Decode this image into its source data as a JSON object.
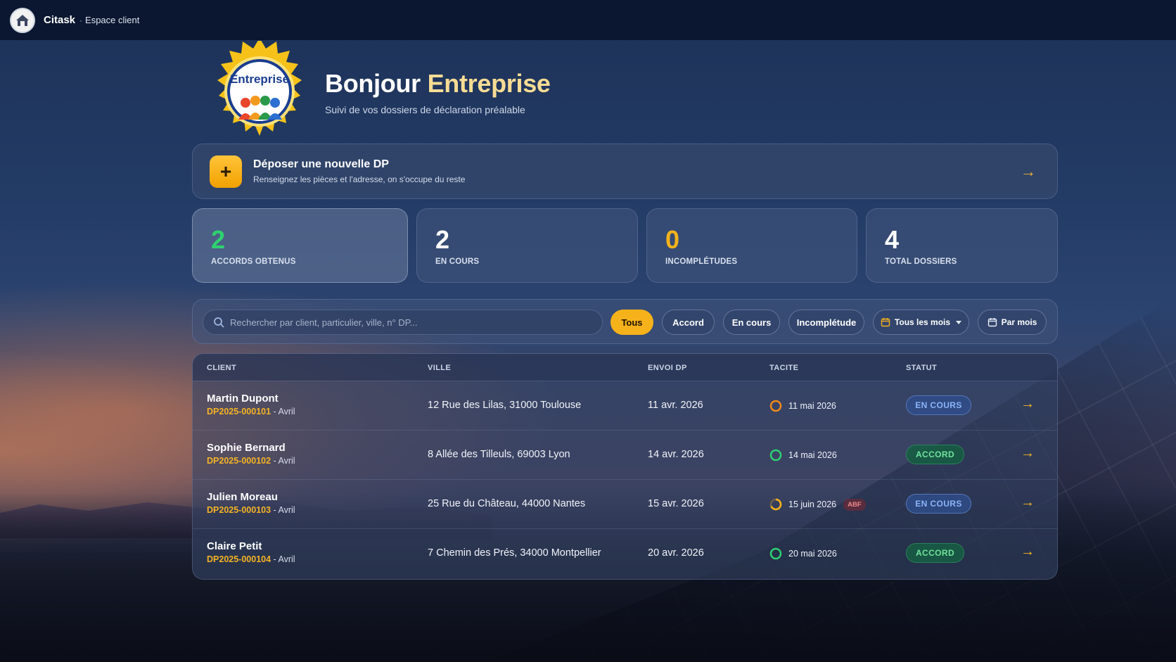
{
  "app": {
    "name": "Citask",
    "separator": "·",
    "section": "Espace client"
  },
  "hero": {
    "badge_text": "Entreprise",
    "greeting": "Bonjour",
    "company": "Entreprise",
    "subtitle": "Suivi de vos dossiers de déclaration préalable"
  },
  "cta": {
    "title": "Déposer une nouvelle DP",
    "description": "Renseignez les pièces et l'adresse, on s'occupe du reste",
    "plus": "+",
    "arrow": "→"
  },
  "stats": [
    {
      "value": "2",
      "label": "ACCORDS OBTENUS",
      "color": "#2fd170"
    },
    {
      "value": "2",
      "label": "EN COURS",
      "color": "#ffffff"
    },
    {
      "value": "0",
      "label": "INCOMPLÉTUDES",
      "color": "#f6b21b"
    },
    {
      "value": "4",
      "label": "TOTAL DOSSIERS",
      "color": "#ffffff"
    }
  ],
  "filters": {
    "search_placeholder": "Rechercher par client, particulier, ville, n° DP...",
    "chips": [
      "Tous",
      "Accord",
      "En cours",
      "Incomplétude"
    ],
    "active_chip": "Tous",
    "month_select": "Tous les mois",
    "group_toggle": "Par mois"
  },
  "table": {
    "headers": [
      "CLIENT",
      "VILLE",
      "ENVOI DP",
      "TACITE",
      "STATUT"
    ],
    "rows": [
      {
        "client": "Martin Dupont",
        "ref": "DP2025-000101",
        "month": "Avril",
        "address": "12 Rue des Lilas, 31000 Toulouse",
        "sent": "11 avr. 2026",
        "tacite": "11 mai 2026",
        "tacite_icon": "ring-orange",
        "abf": "",
        "status": "EN COURS",
        "arrow": "→"
      },
      {
        "client": "Sophie Bernard",
        "ref": "DP2025-000102",
        "month": "Avril",
        "address": "8 Allée des Tilleuls, 69003 Lyon",
        "sent": "14 avr. 2026",
        "tacite": "14 mai 2026",
        "tacite_icon": "ring-green",
        "abf": "",
        "status": "ACCORD",
        "arrow": "→"
      },
      {
        "client": "Julien Moreau",
        "ref": "DP2025-000103",
        "month": "Avril",
        "address": "25 Rue du Château, 44000 Nantes",
        "sent": "15 avr. 2026",
        "tacite": "15 juin 2026",
        "tacite_icon": "ring-yellow-partial",
        "abf": "ABF",
        "status": "EN COURS",
        "arrow": "→"
      },
      {
        "client": "Claire Petit",
        "ref": "DP2025-000104",
        "month": "Avril",
        "address": "7 Chemin des Prés, 34000 Montpellier",
        "sent": "20 avr. 2026",
        "tacite": "20 mai 2026",
        "tacite_icon": "ring-green",
        "abf": "",
        "status": "ACCORD",
        "arrow": "→"
      }
    ]
  },
  "colors": {
    "accent": "#f6b21b",
    "topbar": "#0b1730",
    "status_en_cours": "#8ab4f8",
    "status_accord": "#6fe39c"
  }
}
